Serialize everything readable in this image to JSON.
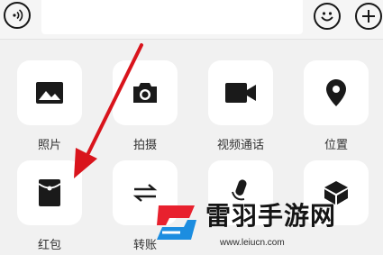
{
  "input_bar": {
    "voice_button": "voice-icon",
    "emoji_button": "emoji-icon",
    "plus_button": "plus-icon",
    "text_value": ""
  },
  "panel": {
    "items": [
      {
        "label": "照片",
        "icon": "photo-icon"
      },
      {
        "label": "拍摄",
        "icon": "camera-icon"
      },
      {
        "label": "视频通话",
        "icon": "video-call-icon"
      },
      {
        "label": "位置",
        "icon": "location-icon"
      },
      {
        "label": "红包",
        "icon": "red-packet-icon"
      },
      {
        "label": "转账",
        "icon": "transfer-icon"
      },
      {
        "label": "",
        "icon": "voice-input-icon"
      },
      {
        "label": "",
        "icon": "cube-icon"
      }
    ]
  },
  "annotation": {
    "arrow_color": "#d9141c"
  },
  "watermark": {
    "name": "雷羽手游网",
    "url": "www.leiucn.com",
    "logo_colors": [
      "#e8212e",
      "#1c8de0"
    ]
  }
}
